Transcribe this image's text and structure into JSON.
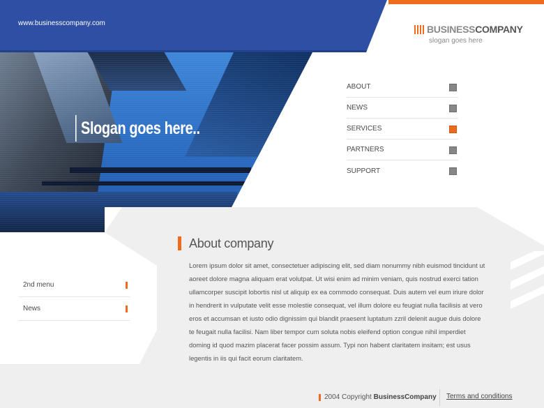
{
  "header": {
    "site_url": "www.businesscompany.com",
    "logo": {
      "part1": "BUSINESS",
      "part2": "COMPANY",
      "slogan": "slogan goes here"
    }
  },
  "hero": {
    "slogan": "Slogan goes here.."
  },
  "menu": {
    "items": [
      {
        "label": "ABOUT",
        "active": false
      },
      {
        "label": "NEWS",
        "active": false
      },
      {
        "label": "SERVICES",
        "active": true
      },
      {
        "label": "PARTNERS",
        "active": false
      },
      {
        "label": "SUPPORT",
        "active": false
      }
    ]
  },
  "side_menu": {
    "items": [
      {
        "label": "2nd menu"
      },
      {
        "label": "News"
      }
    ]
  },
  "content": {
    "title": "About company",
    "body": "Lorem ipsum dolor sit amet, consectetuer adipiscing elit, sed diam nonummy nibh euismod tincidunt ut aoreet dolore magna aliquam erat volutpat. Ut wisi enim ad minim veniam, quis nostrud exerci tation ullamcorper suscipit lobortis nisl ut aliquip ex ea commodo consequat. Duis autem vel eum iriure dolor in hendrerit in vulputate velit esse molestie consequat, vel illum dolore eu feugiat nulla facilisis at vero eros et accumsan et iusto odio dignissim qui blandit praesent luptatum zzril delenit augue duis dolore te feugait nulla facilisi. Nam liber tempor cum soluta nobis eleifend option congue nihil imperdiet doming id quod mazim placerat facer possim assum. Typi non habent claritatem insitam; est usus legentis in iis qui facit eorum claritatem."
  },
  "footer": {
    "copyright_prefix": "2004 Copyright",
    "copyright_company": "BusinessCompany",
    "terms_link": "Terms and conditions"
  },
  "colors": {
    "brand_blue": "#2e4fa3",
    "accent_orange": "#ee6a1c",
    "menu_square_grey": "#878787",
    "band_grey": "#efefef"
  }
}
